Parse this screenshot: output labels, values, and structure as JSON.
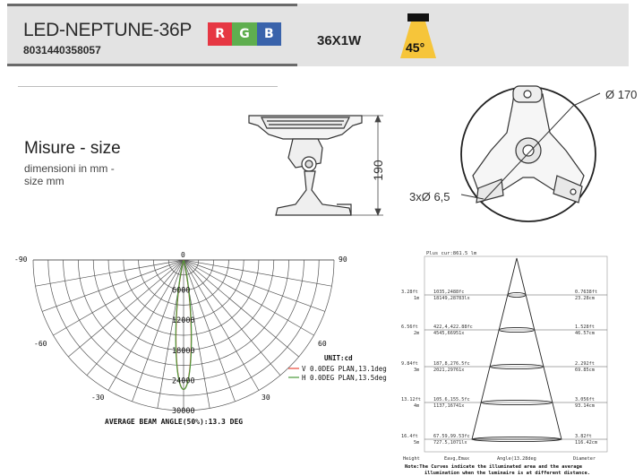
{
  "header": {
    "model": "LED-NEPTUNE-36P",
    "code": "8031440358057",
    "rgb": [
      "R",
      "G",
      "B"
    ],
    "rgb_colors": [
      "#e63743",
      "#5fae4f",
      "#3a63ab"
    ],
    "power": "36X1W",
    "beam_angle": "45°",
    "beam_color": "#f6c53a"
  },
  "size": {
    "title": "Misure - size",
    "subtitle": "dimensioni in mm -",
    "subtitle2": "size mm"
  },
  "drawing": {
    "diameter": "Ø 170",
    "height": "190",
    "holes": "3xØ 6,5"
  },
  "polar": {
    "angles": {
      "left90": "-90",
      "right90": "90",
      "zero": "0",
      "left60": "-60",
      "right60": "60",
      "left30": "-30",
      "right30": "30"
    },
    "rings": [
      "6000",
      "12000",
      "18000",
      "24000",
      "30000"
    ],
    "unit": "UNIT:cd",
    "legend": [
      {
        "text": "V 0.0DEG PLAN,13.1deg",
        "color": "#e8483a"
      },
      {
        "text": "H 0.0DEG PLAN,13.5deg",
        "color": "#4a9a3a"
      }
    ],
    "footer": "AVERAGE BEAM ANGLE(50%):13.3 DEG"
  },
  "chart_data": {
    "type": "line",
    "title": "",
    "series": [
      {
        "name": "V 0.0DEG PLAN,13.1deg",
        "beam_angle_deg": 13.1
      },
      {
        "name": "H 0.0DEG PLAN,13.5deg",
        "beam_angle_deg": 13.5
      }
    ],
    "radial_ticks": [
      6000,
      12000,
      18000,
      24000,
      30000
    ],
    "angle_range": [
      -90,
      90
    ],
    "average_beam_angle_deg": 13.3
  },
  "cone": {
    "top": "Plus cur:861.5 lm",
    "rows": [
      {
        "h1": "3.28ft",
        "h2": "1m",
        "e1": "1035,2488fc",
        "e2": "18149,28783lx",
        "d1": "0.7638ft",
        "d2": "23.28cm"
      },
      {
        "h1": "6.56ft",
        "h2": "2m",
        "e1": "422,4,422.88fc",
        "e2": "4545,66951x",
        "d1": "1.528ft",
        "d2": "46.57cm"
      },
      {
        "h1": "9.84ft",
        "h2": "3m",
        "e1": "187,8,276.5fc",
        "e2": "2021,29761x",
        "d1": "2.292ft",
        "d2": "69.85cm"
      },
      {
        "h1": "13.12ft",
        "h2": "4m",
        "e1": "105.6,155.5fc",
        "e2": "1137,16741x",
        "d1": "3.056ft",
        "d2": "93.14cm"
      },
      {
        "h1": "16.4ft",
        "h2": "5m",
        "e1": "67.59,99.53fc",
        "e2": "727.5,1071lx",
        "d1": "3.82ft",
        "d2": "116.42cm"
      }
    ],
    "footer_height": "Height",
    "footer_e": "Eavg,Emax",
    "footer_angle": "Angle(13.28deg",
    "footer_d": "Diameter",
    "note": "Note:The Curves indicate the illuminated area and the average",
    "note2": "illumination when the luminaire is at different distance."
  }
}
